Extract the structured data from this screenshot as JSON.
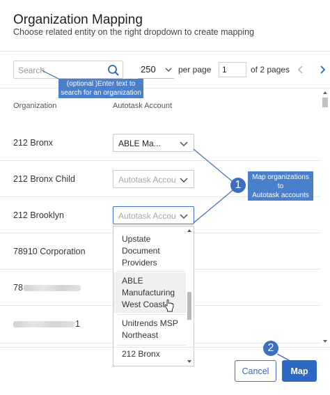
{
  "dialog": {
    "title": "Organization Mapping",
    "subtitle": "Choose related entity on the right dropdown to create mapping"
  },
  "toolbar": {
    "search_placeholder": "Search",
    "page_size": "250",
    "per_page_label": "per page",
    "page_number": "1",
    "of_pages_label": "of 2 pages"
  },
  "table": {
    "headers": {
      "organization": "Organization",
      "account": "Autotask Account"
    },
    "rows": [
      {
        "organization": "212 Bronx",
        "account_value": "ABLE Ma...",
        "account_placeholder": ""
      },
      {
        "organization": "212 Bronx Child",
        "account_value": "",
        "account_placeholder": "Autotask Account"
      },
      {
        "organization": "212 Brooklyn",
        "account_value": "",
        "account_placeholder": "Autotask Account"
      },
      {
        "organization": "78910 Corporation"
      },
      {
        "organization": "78"
      },
      {
        "organization": "1"
      }
    ]
  },
  "dropdown_options": [
    {
      "line1": "Upstate",
      "line2": "Document",
      "line3": "Providers"
    },
    {
      "line1": "ABLE",
      "line2": "Manufacturing",
      "line3": "West Coast"
    },
    {
      "line1": "Unitrends MSP",
      "line2": "Northeast"
    },
    {
      "line1": "212 Bronx"
    }
  ],
  "footer": {
    "cancel_label": "Cancel",
    "map_label": "Map"
  },
  "annotations": {
    "search_callout_line1": "(optional )Enter text to",
    "search_callout_line2": "search for an organization",
    "map_callout_line1": "Map organizations",
    "map_callout_line2": "to",
    "map_callout_line3": "Autotask accounts",
    "badge_1": "1",
    "badge_2": "2"
  },
  "colors": {
    "accent": "#2d68c4",
    "callout": "#4a7fcb",
    "badge": "#3d6fbe"
  },
  "icons": [
    "search-icon",
    "chevron-down-icon",
    "chevron-left-icon",
    "chevron-right-icon",
    "cursor-hand-icon"
  ]
}
